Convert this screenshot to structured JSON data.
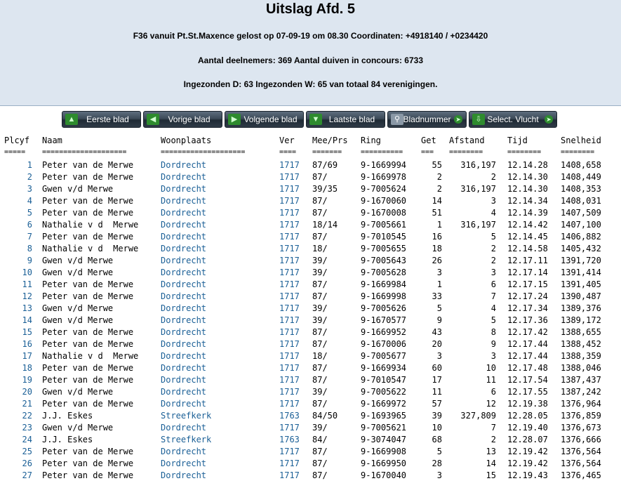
{
  "header": {
    "title": "Uitslag Afd. 5",
    "line1": "F36 vanuit Pt.St.Maxence gelost op 07-09-19 om 08.30 Coordinaten: +4918140 / +0234420",
    "line2": "Aantal deelnemers: 369 Aantal duiven in concours: 6733",
    "line3": "Ingezonden D: 63 Ingezonden W: 65 van totaal 84 verenigingen."
  },
  "toolbar": {
    "buttons": [
      {
        "label": "Eerste blad",
        "icon": "arrow-up-icon"
      },
      {
        "label": "Vorige blad",
        "icon": "arrow-left-icon"
      },
      {
        "label": "Volgende blad",
        "icon": "arrow-right-icon"
      },
      {
        "label": "Laatste blad",
        "icon": "arrow-down-icon"
      },
      {
        "label": "Bladnummer",
        "icon": "search-icon"
      },
      {
        "label": "Select. Vlucht",
        "icon": "download-icon"
      }
    ]
  },
  "table": {
    "columns": [
      "Plcyf",
      "Naam",
      "Woonplaats",
      "Ver",
      "Mee/Prs",
      "Ring",
      "Get",
      "Afstand",
      "Tijd",
      "Snelheid"
    ],
    "separators": [
      "=====",
      "====================",
      "====================",
      "====",
      "=======",
      "==========",
      "===",
      "========",
      "========",
      "========"
    ],
    "rows": [
      [
        "1",
        "Peter van de Merwe",
        "Dordrecht",
        "1717",
        "87/69",
        "9-1669994",
        "55",
        "316,197",
        "12.14.28",
        "1408,658"
      ],
      [
        "2",
        "Peter van de Merwe",
        "Dordrecht",
        "1717",
        "87/",
        "9-1669978",
        "2",
        "2",
        "12.14.30",
        "1408,449"
      ],
      [
        "3",
        "Gwen v/d Merwe",
        "Dordrecht",
        "1717",
        "39/35",
        "9-7005624",
        "2",
        "316,197",
        "12.14.30",
        "1408,353"
      ],
      [
        "4",
        "Peter van de Merwe",
        "Dordrecht",
        "1717",
        "87/",
        "9-1670060",
        "14",
        "3",
        "12.14.34",
        "1408,031"
      ],
      [
        "5",
        "Peter van de Merwe",
        "Dordrecht",
        "1717",
        "87/",
        "9-1670008",
        "51",
        "4",
        "12.14.39",
        "1407,509"
      ],
      [
        "6",
        "Nathalie v d  Merwe",
        "Dordrecht",
        "1717",
        "18/14",
        "9-7005661",
        "1",
        "316,197",
        "12.14.42",
        "1407,100"
      ],
      [
        "7",
        "Peter van de Merwe",
        "Dordrecht",
        "1717",
        "87/",
        "9-7010545",
        "16",
        "5",
        "12.14.45",
        "1406,882"
      ],
      [
        "8",
        "Nathalie v d  Merwe",
        "Dordrecht",
        "1717",
        "18/",
        "9-7005655",
        "18",
        "2",
        "12.14.58",
        "1405,432"
      ],
      [
        "9",
        "Gwen v/d Merwe",
        "Dordrecht",
        "1717",
        "39/",
        "9-7005643",
        "26",
        "2",
        "12.17.11",
        "1391,720"
      ],
      [
        "10",
        "Gwen v/d Merwe",
        "Dordrecht",
        "1717",
        "39/",
        "9-7005628",
        "3",
        "3",
        "12.17.14",
        "1391,414"
      ],
      [
        "11",
        "Peter van de Merwe",
        "Dordrecht",
        "1717",
        "87/",
        "9-1669984",
        "1",
        "6",
        "12.17.15",
        "1391,405"
      ],
      [
        "12",
        "Peter van de Merwe",
        "Dordrecht",
        "1717",
        "87/",
        "9-1669998",
        "33",
        "7",
        "12.17.24",
        "1390,487"
      ],
      [
        "13",
        "Gwen v/d Merwe",
        "Dordrecht",
        "1717",
        "39/",
        "9-7005626",
        "5",
        "4",
        "12.17.34",
        "1389,376"
      ],
      [
        "14",
        "Gwen v/d Merwe",
        "Dordrecht",
        "1717",
        "39/",
        "9-1670577",
        "9",
        "5",
        "12.17.36",
        "1389,172"
      ],
      [
        "15",
        "Peter van de Merwe",
        "Dordrecht",
        "1717",
        "87/",
        "9-1669952",
        "43",
        "8",
        "12.17.42",
        "1388,655"
      ],
      [
        "16",
        "Peter van de Merwe",
        "Dordrecht",
        "1717",
        "87/",
        "9-1670006",
        "20",
        "9",
        "12.17.44",
        "1388,452"
      ],
      [
        "17",
        "Nathalie v d  Merwe",
        "Dordrecht",
        "1717",
        "18/",
        "9-7005677",
        "3",
        "3",
        "12.17.44",
        "1388,359"
      ],
      [
        "18",
        "Peter van de Merwe",
        "Dordrecht",
        "1717",
        "87/",
        "9-1669934",
        "60",
        "10",
        "12.17.48",
        "1388,046"
      ],
      [
        "19",
        "Peter van de Merwe",
        "Dordrecht",
        "1717",
        "87/",
        "9-7010547",
        "17",
        "11",
        "12.17.54",
        "1387,437"
      ],
      [
        "20",
        "Gwen v/d Merwe",
        "Dordrecht",
        "1717",
        "39/",
        "9-7005622",
        "11",
        "6",
        "12.17.55",
        "1387,242"
      ],
      [
        "21",
        "Peter van de Merwe",
        "Dordrecht",
        "1717",
        "87/",
        "9-1669972",
        "57",
        "12",
        "12.19.38",
        "1376,964"
      ],
      [
        "22",
        "J.J. Eskes",
        "Streefkerk",
        "1763",
        "84/50",
        "9-1693965",
        "39",
        "327,809",
        "12.28.05",
        "1376,859"
      ],
      [
        "23",
        "Gwen v/d Merwe",
        "Dordrecht",
        "1717",
        "39/",
        "9-7005621",
        "10",
        "7",
        "12.19.40",
        "1376,673"
      ],
      [
        "24",
        "J.J. Eskes",
        "Streefkerk",
        "1763",
        "84/",
        "9-3074047",
        "68",
        "2",
        "12.28.07",
        "1376,666"
      ],
      [
        "25",
        "Peter van de Merwe",
        "Dordrecht",
        "1717",
        "87/",
        "9-1669908",
        "5",
        "13",
        "12.19.42",
        "1376,564"
      ],
      [
        "26",
        "Peter van de Merwe",
        "Dordrecht",
        "1717",
        "87/",
        "9-1669950",
        "28",
        "14",
        "12.19.42",
        "1376,564"
      ],
      [
        "27",
        "Peter van de Merwe",
        "Dordrecht",
        "1717",
        "87/",
        "9-1670040",
        "3",
        "15",
        "12.19.43",
        "1376,465"
      ]
    ]
  }
}
